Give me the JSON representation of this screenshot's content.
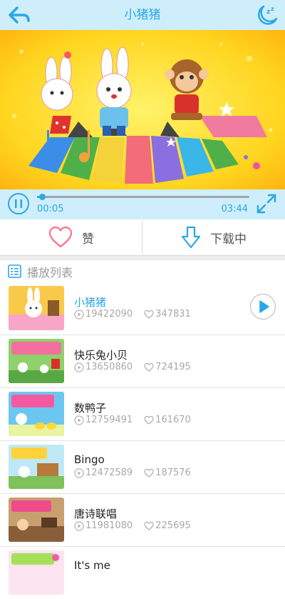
{
  "header": {
    "title": "小猪猪",
    "back_icon": "back-arrow-icon",
    "sleep_icon": "moon-sleep-icon"
  },
  "player": {
    "current_time": "00:05",
    "total_time": "03:44",
    "progress": 0.022,
    "accent_color": "#2aa7e6"
  },
  "actions": {
    "like_label": "赞",
    "download_label": "下载中"
  },
  "playlist": {
    "title": "播放列表",
    "items": [
      {
        "name": "小猪猪",
        "plays": "19422090",
        "likes": "347831",
        "active": true
      },
      {
        "name": "快乐兔小贝",
        "plays": "13650860",
        "likes": "724195",
        "active": false
      },
      {
        "name": "数鸭子",
        "plays": "12759491",
        "likes": "161670",
        "active": false
      },
      {
        "name": "Bingo",
        "plays": "12472589",
        "likes": "187576",
        "active": false
      },
      {
        "name": "唐诗联唱",
        "plays": "11981080",
        "likes": "225695",
        "active": false
      },
      {
        "name": "It's me",
        "plays": "",
        "likes": "",
        "active": false
      }
    ]
  }
}
